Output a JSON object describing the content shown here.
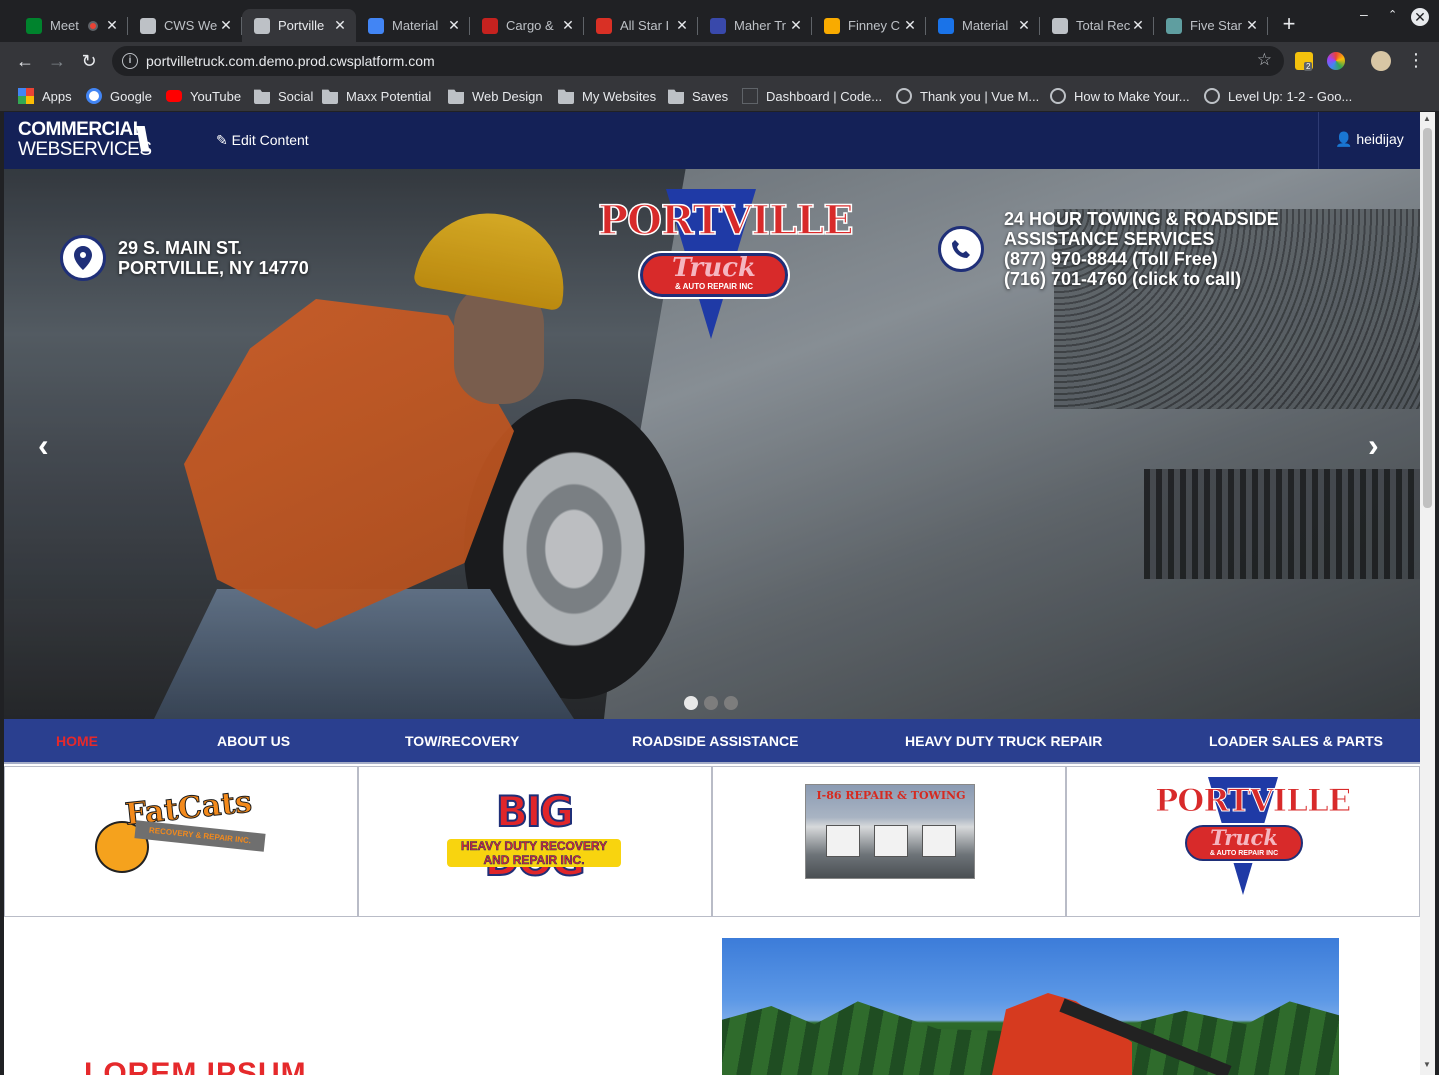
{
  "browser": {
    "tabs": [
      {
        "title": "Meet",
        "fav_color": "#00832d",
        "active": false,
        "recording": true
      },
      {
        "title": "CWS Web",
        "fav_color": "#bdc1c6",
        "active": false
      },
      {
        "title": "Portville",
        "fav_color": "#bdc1c6",
        "active": true
      },
      {
        "title": "Material",
        "fav_color": "#4285f4",
        "active": false
      },
      {
        "title": "Cargo &",
        "fav_color": "#c5221f",
        "active": false
      },
      {
        "title": "All Star I",
        "fav_color": "#d93025",
        "active": false
      },
      {
        "title": "Maher Tr",
        "fav_color": "#3949ab",
        "active": false
      },
      {
        "title": "Finney C",
        "fav_color": "#f9ab00",
        "active": false
      },
      {
        "title": "Material",
        "fav_color": "#1a73e8",
        "active": false
      },
      {
        "title": "Total Rec",
        "fav_color": "#bdc1c6",
        "active": false
      },
      {
        "title": "Five Star",
        "fav_color": "#5f9ea0",
        "active": false
      }
    ],
    "url": "portvilletruck.com.demo.prod.cwsplatform.com",
    "bookmarks": [
      {
        "label": "Apps",
        "icon": "apps-grid-icon"
      },
      {
        "label": "Google",
        "icon": "google-icon"
      },
      {
        "label": "YouTube",
        "icon": "youtube-icon"
      },
      {
        "label": "Social",
        "icon": "folder-icon"
      },
      {
        "label": "Maxx Potential",
        "icon": "folder-icon"
      },
      {
        "label": "Web Design",
        "icon": "folder-icon"
      },
      {
        "label": "My Websites",
        "icon": "folder-icon"
      },
      {
        "label": "Saves",
        "icon": "folder-icon"
      },
      {
        "label": "Dashboard | Code...",
        "icon": "codepen-icon"
      },
      {
        "label": "Thank you | Vue M...",
        "icon": "globe-icon"
      },
      {
        "label": "How to Make Your...",
        "icon": "globe-icon"
      },
      {
        "label": "Level Up: 1-2 - Goo...",
        "icon": "globe-icon"
      }
    ],
    "extension_badge": "2"
  },
  "cms": {
    "logo_line1": "COMMERCIAL",
    "logo_line2": "WEBSERVICES",
    "logo_mark": "\\\\\\\\",
    "edit_label": "Edit Content",
    "username": "heidijay"
  },
  "hero": {
    "address_line1": "29 S. MAIN ST.",
    "address_line2": "PORTVILLE, NY 14770",
    "service_line1": "24 HOUR TOWING & ROADSIDE",
    "service_line2": "ASSISTANCE SERVICES",
    "phone_tollfree": "(877) 970-8844 (Toll Free)",
    "phone_local": "(716) 701-4760 (click to call)",
    "logo_word": "PORTVILLE",
    "logo_truck": "Truck",
    "logo_sub": "& AUTO REPAIR INC",
    "slides": 3,
    "active_slide": 1
  },
  "nav": [
    {
      "label": "HOME",
      "active": true
    },
    {
      "label": "ABOUT US",
      "active": false
    },
    {
      "label": "TOW/RECOVERY",
      "active": false
    },
    {
      "label": "ROADSIDE ASSISTANCE",
      "active": false
    },
    {
      "label": "HEAVY DUTY TRUCK REPAIR",
      "active": false
    },
    {
      "label": "LOADER SALES & PARTS",
      "active": false
    }
  ],
  "partners": {
    "fatcats_word": "FatCats",
    "fatcats_band": "RECOVERY & REPAIR INC.",
    "bigdog_word": "BIG DOG",
    "bigdog_sub": "HEAVY DUTY RECOVERY AND REPAIR INC.",
    "i86_caption": "I-86 REPAIR & TOWING",
    "portville_word": "PORTVILLE",
    "portville_truck": "Truck",
    "portville_sub": "& AUTO REPAIR INC"
  },
  "content": {
    "heading": "LOREM IPSUM"
  },
  "colors": {
    "brand_navy": "#142157",
    "nav_blue": "#2a3f8f",
    "accent_red": "#e5292b"
  }
}
